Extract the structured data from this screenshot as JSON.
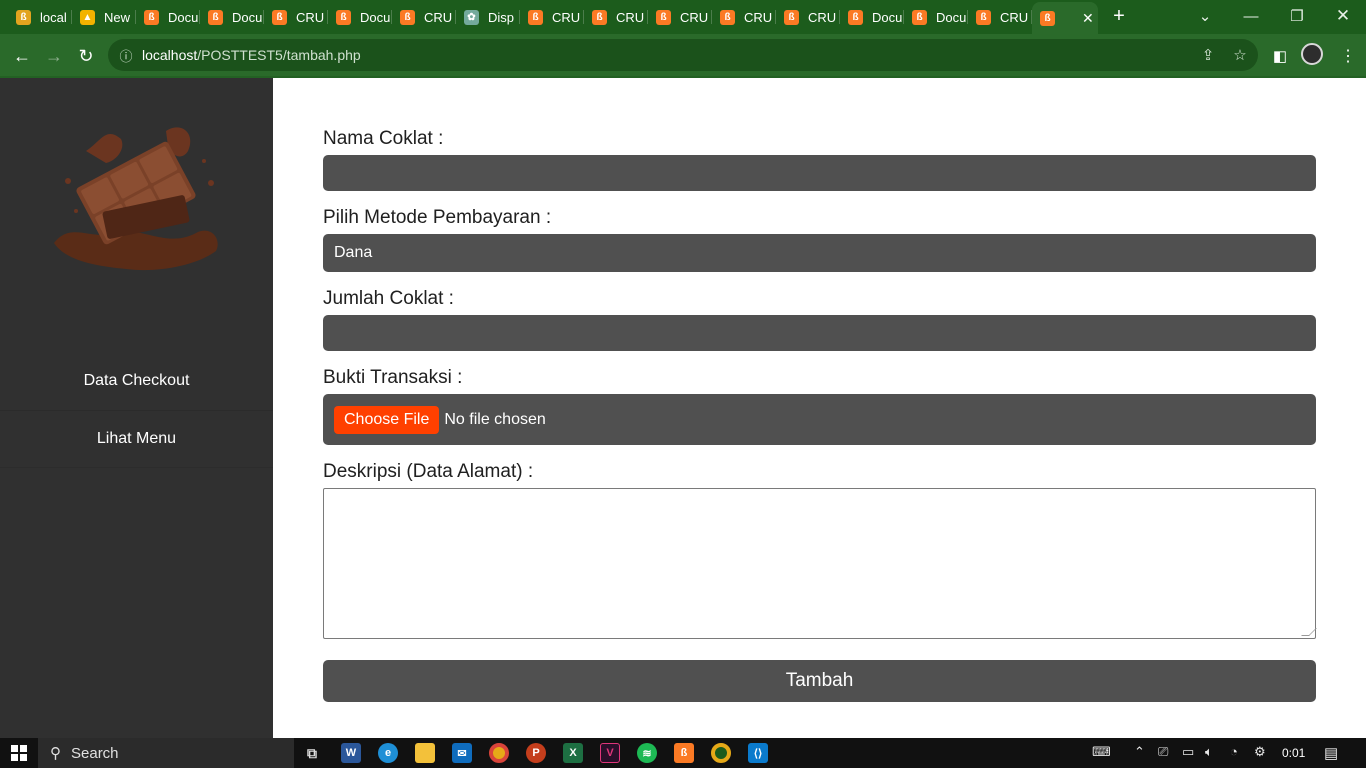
{
  "browser": {
    "tabs": [
      {
        "title": "local",
        "icon": "xampp-icon",
        "color": "#e2a41f"
      },
      {
        "title": "New",
        "icon": "drive-icon",
        "color": "#f2b300"
      },
      {
        "title": "Docu",
        "icon": "xampp-icon",
        "color": "#fb7a24"
      },
      {
        "title": "Docu",
        "icon": "xampp-icon",
        "color": "#fb7a24"
      },
      {
        "title": "CRU",
        "icon": "xampp-icon",
        "color": "#fb7a24"
      },
      {
        "title": "Docu",
        "icon": "xampp-icon",
        "color": "#fb7a24"
      },
      {
        "title": "CRU",
        "icon": "xampp-icon",
        "color": "#fb7a24"
      },
      {
        "title": "Disp",
        "icon": "chatgpt-icon",
        "color": "#74aa9c"
      },
      {
        "title": "CRU",
        "icon": "xampp-icon",
        "color": "#fb7a24"
      },
      {
        "title": "CRU",
        "icon": "xampp-icon",
        "color": "#fb7a24"
      },
      {
        "title": "CRU",
        "icon": "xampp-icon",
        "color": "#fb7a24"
      },
      {
        "title": "CRU",
        "icon": "xampp-icon",
        "color": "#fb7a24"
      },
      {
        "title": "CRU",
        "icon": "xampp-icon",
        "color": "#fb7a24"
      },
      {
        "title": "Docu",
        "icon": "xampp-icon",
        "color": "#fb7a24"
      },
      {
        "title": "Docu",
        "icon": "xampp-icon",
        "color": "#fb7a24"
      },
      {
        "title": "CRU",
        "icon": "xampp-icon",
        "color": "#fb7a24"
      }
    ],
    "active_tab_icon": "xampp-icon",
    "url_host": "localhost",
    "url_path": "/POSTTEST5/tambah.php",
    "accent_color": "#2a6a2a"
  },
  "sidebar": {
    "logo": "chocolate-splash-logo",
    "links": [
      "Data Checkout",
      "Lihat Menu"
    ]
  },
  "form": {
    "nama_label": "Nama Coklat :",
    "nama_value": "",
    "metode_label": "Pilih Metode Pembayaran :",
    "metode_value": "Dana",
    "jumlah_label": "Jumlah Coklat :",
    "jumlah_value": "",
    "bukti_label": "Bukti Transaksi :",
    "choose_file": "Choose File",
    "no_file": "No file chosen",
    "deskripsi_label": "Deskripsi (Data Alamat) :",
    "deskripsi_value": "",
    "submit_label": "Tambah",
    "choose_file_color": "#ff4000"
  },
  "taskbar": {
    "search_placeholder": "Search",
    "clock": "0:01"
  }
}
